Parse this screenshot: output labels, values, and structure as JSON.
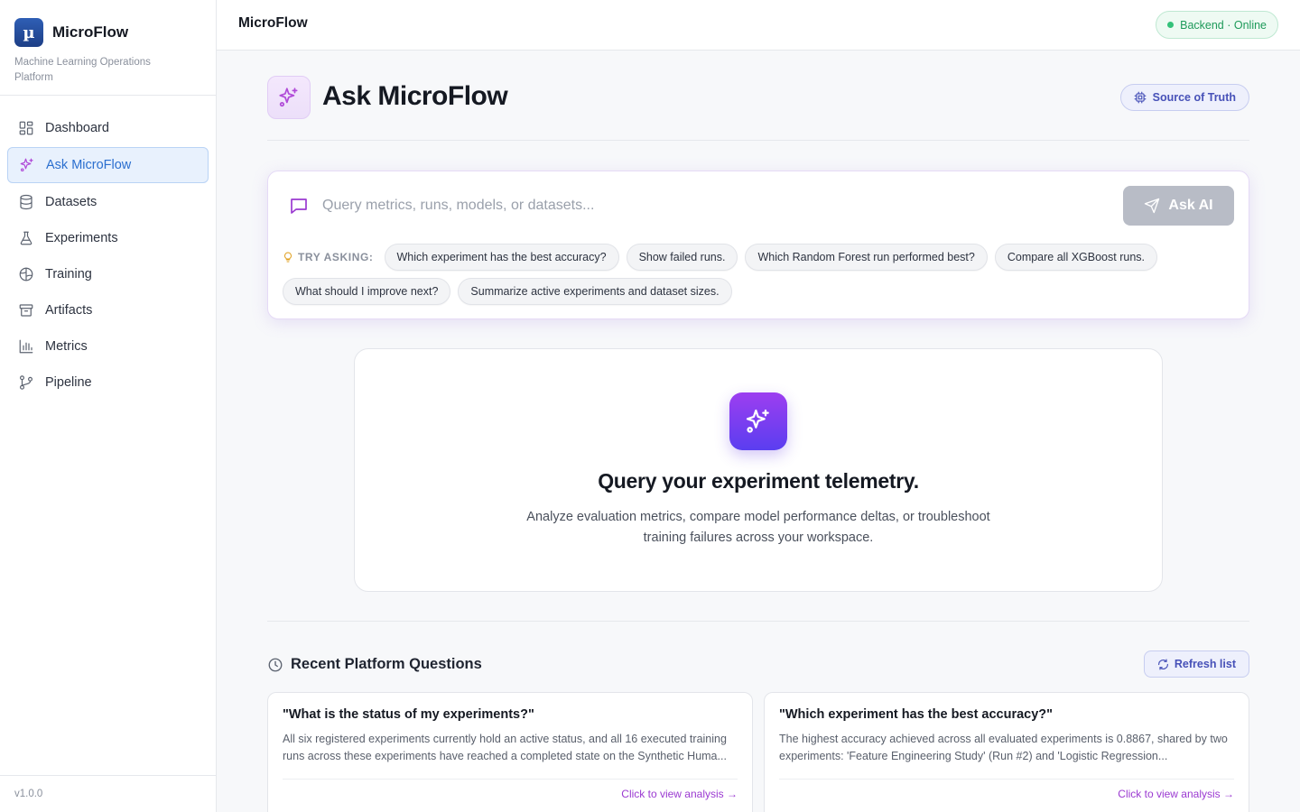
{
  "brand": {
    "logo_glyph": "µ",
    "name": "MicroFlow",
    "subtitle": "Machine Learning Operations Platform"
  },
  "nav": [
    {
      "label": "Dashboard",
      "icon": "grid-icon",
      "active": false
    },
    {
      "label": "Ask MicroFlow",
      "icon": "sparkles-icon",
      "active": true
    },
    {
      "label": "Datasets",
      "icon": "database-icon",
      "active": false
    },
    {
      "label": "Experiments",
      "icon": "flask-icon",
      "active": false
    },
    {
      "label": "Training",
      "icon": "brain-icon",
      "active": false
    },
    {
      "label": "Artifacts",
      "icon": "archive-icon",
      "active": false
    },
    {
      "label": "Metrics",
      "icon": "bar-chart-icon",
      "active": false
    },
    {
      "label": "Pipeline",
      "icon": "git-branch-icon",
      "active": false
    }
  ],
  "version": "v1.0.0",
  "topbar": {
    "title": "MicroFlow",
    "status": "Backend · Online",
    "status_color": "#1e9a5a"
  },
  "page": {
    "title": "Ask MicroFlow",
    "source_button": "Source of Truth"
  },
  "query": {
    "placeholder": "Query metrics, runs, models, or datasets...",
    "value": "",
    "ask_button": "Ask AI",
    "try_label": "TRY ASKING:",
    "suggestions": [
      "Which experiment has the best accuracy?",
      "Show failed runs.",
      "Which Random Forest run performed best?",
      "Compare all XGBoost runs.",
      "What should I improve next?",
      "Summarize active experiments and dataset sizes."
    ]
  },
  "hero": {
    "title": "Query your experiment telemetry.",
    "text": "Analyze evaluation metrics, compare model performance deltas, or troubleshoot training failures across your workspace."
  },
  "recent": {
    "title": "Recent Platform Questions",
    "refresh_button": "Refresh list",
    "items": [
      {
        "question": "\"What is the status of my experiments?\"",
        "answer": "All six registered experiments currently hold an active status, and all 16 executed training runs across these experiments have reached a completed state on the Synthetic Huma...",
        "link": "Click to view analysis →"
      },
      {
        "question": "\"Which experiment has the best accuracy?\"",
        "answer": "The highest accuracy achieved across all evaluated experiments is 0.8867, shared by two experiments: 'Feature Engineering Study' (Run #2) and 'Logistic Regression...",
        "link": "Click to view analysis →"
      }
    ]
  },
  "colors": {
    "accent_purple": "#9b3ad1",
    "active_nav_bg": "#e8f1fd",
    "ask_button_disabled": "#b8bcc6"
  }
}
